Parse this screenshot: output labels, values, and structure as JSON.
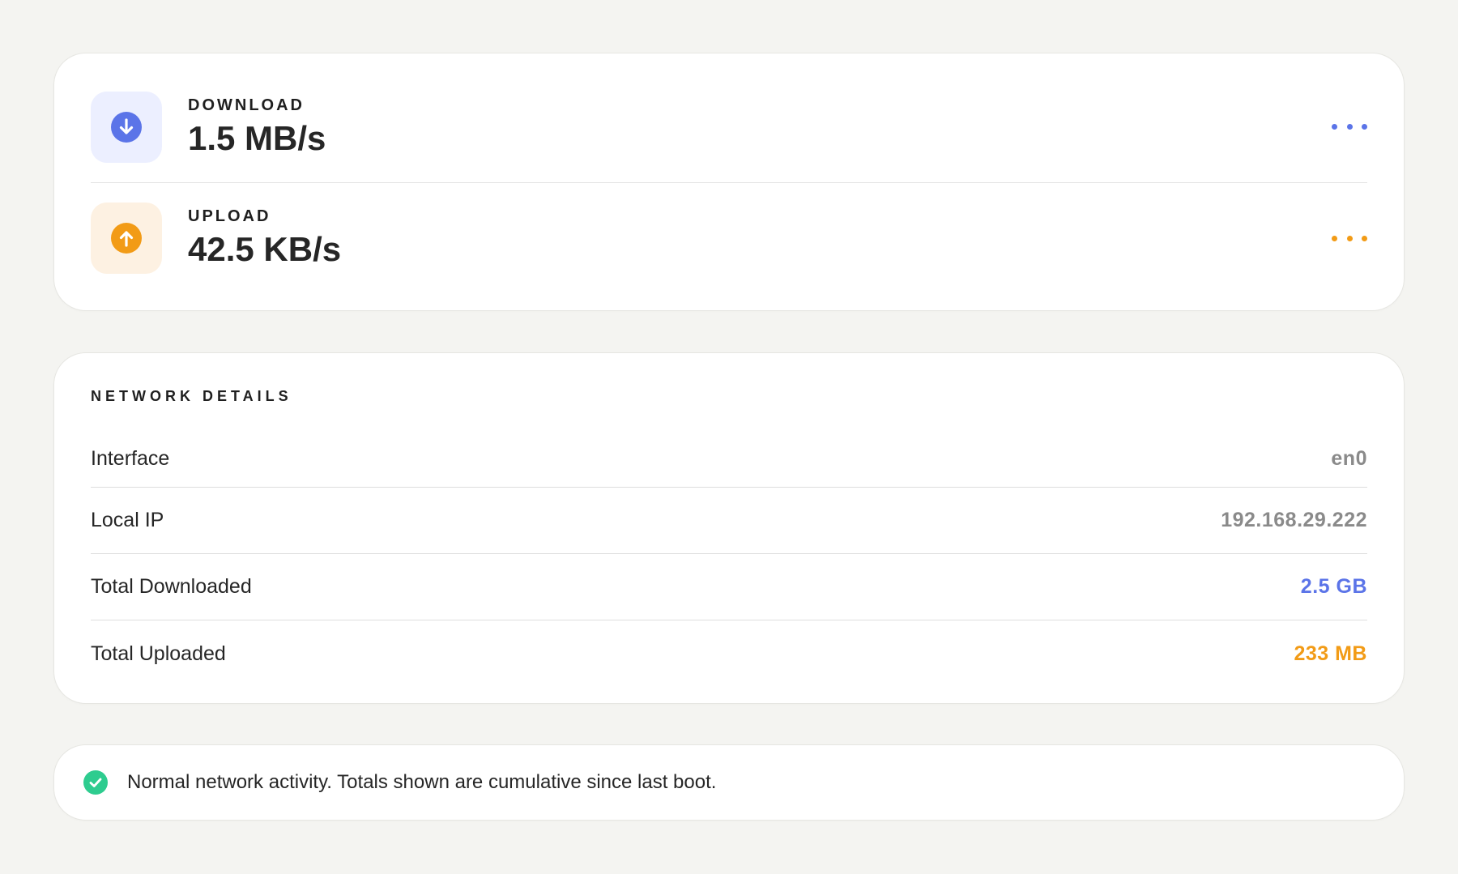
{
  "speed": {
    "download": {
      "label": "DOWNLOAD",
      "value": "1.5 MB/s",
      "icon": "arrow-down-circle-icon",
      "accent": "#5b74e8",
      "tile_bg": "#ecefff"
    },
    "upload": {
      "label": "UPLOAD",
      "value": "42.5 KB/s",
      "icon": "arrow-up-circle-icon",
      "accent": "#f29b16",
      "tile_bg": "#fdf1e2"
    }
  },
  "details": {
    "title": "NETWORK DETAILS",
    "rows": [
      {
        "label": "Interface",
        "value": "en0",
        "color": "#8a8a8a"
      },
      {
        "label": "Local IP",
        "value": "192.168.29.222",
        "color": "#8a8a8a"
      },
      {
        "label": "Total Downloaded",
        "value": "2.5 GB",
        "color": "#5b74e8"
      },
      {
        "label": "Total Uploaded",
        "value": "233 MB",
        "color": "#f29b16"
      }
    ]
  },
  "status": {
    "icon": "check-circle-icon",
    "color": "#2ecc8f",
    "message": "Normal network activity. Totals shown are cumulative since last boot."
  }
}
